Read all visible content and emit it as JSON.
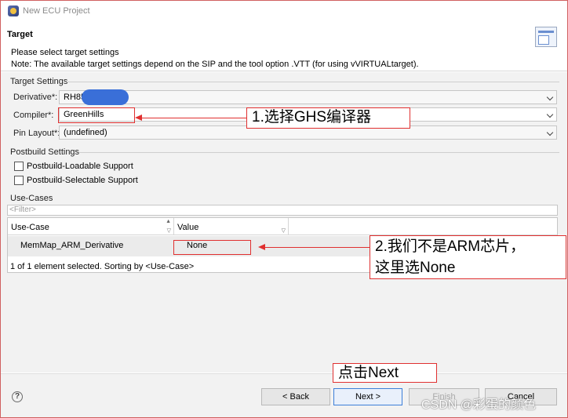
{
  "window": {
    "title": "New ECU Project"
  },
  "header": {
    "title": "Target",
    "line1": "Please select target settings",
    "line2": "Note: The available target settings depend on the SIP and the tool option .VTT (for using vVIRTUALtarget)."
  },
  "target_settings": {
    "group_label": "Target Settings",
    "derivative": {
      "label": "Derivative*:",
      "value": "RH85"
    },
    "compiler": {
      "label": "Compiler*:",
      "value": "GreenHills"
    },
    "pin_layout": {
      "label": "Pin Layout*:",
      "value": "(undefined)"
    }
  },
  "postbuild": {
    "group_label": "Postbuild Settings",
    "loadable": {
      "label": "Postbuild-Loadable Support",
      "checked": false
    },
    "selectable": {
      "label": "Postbuild-Selectable Support",
      "checked": false
    }
  },
  "use_cases": {
    "group_label": "Use-Cases",
    "filter_placeholder": "<Filter>",
    "columns": [
      "Use-Case",
      "Value"
    ],
    "rows": [
      {
        "use_case": "MemMap_ARM_Derivative",
        "value": "None"
      }
    ],
    "status": "1 of 1 element selected. Sorting by <Use-Case>"
  },
  "footer": {
    "help": "?",
    "back": "< Back",
    "next": "Next >",
    "finish": "Finish",
    "cancel": "Cancel"
  },
  "annotations": {
    "compiler_note": "1.选择GHS编译器",
    "value_note_line1": "2.我们不是ARM芯片，",
    "value_note_line2": "这里选None",
    "next_note": "点击Next"
  },
  "watermark": "CSDN @彩蛋的颜色",
  "colors": {
    "annotation": "#e03030",
    "accent": "#3d7fd8",
    "background": "#f2f2f2"
  }
}
